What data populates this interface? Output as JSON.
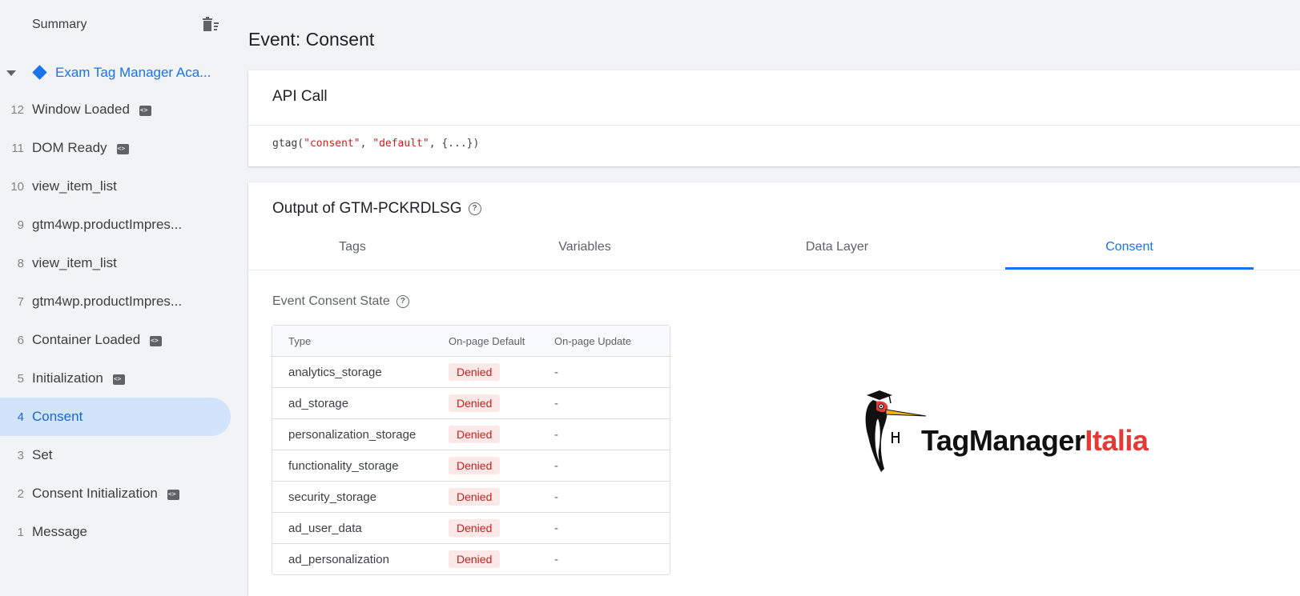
{
  "sidebar": {
    "summary_label": "Summary",
    "container_label": "Exam Tag Manager Aca...",
    "items": [
      {
        "num": "12",
        "label": "Window Loaded",
        "badge": true
      },
      {
        "num": "11",
        "label": "DOM Ready",
        "badge": true
      },
      {
        "num": "10",
        "label": "view_item_list",
        "badge": false
      },
      {
        "num": "9",
        "label": "gtm4wp.productImpres...",
        "badge": false
      },
      {
        "num": "8",
        "label": "view_item_list",
        "badge": false
      },
      {
        "num": "7",
        "label": "gtm4wp.productImpres...",
        "badge": false
      },
      {
        "num": "6",
        "label": "Container Loaded",
        "badge": true
      },
      {
        "num": "5",
        "label": "Initialization",
        "badge": true
      },
      {
        "num": "4",
        "label": "Consent",
        "badge": false,
        "active": true
      },
      {
        "num": "3",
        "label": "Set",
        "badge": false
      },
      {
        "num": "2",
        "label": "Consent Initialization",
        "badge": true
      },
      {
        "num": "1",
        "label": "Message",
        "badge": false
      }
    ]
  },
  "main": {
    "title": "Event: Consent",
    "api_call": {
      "title": "API Call",
      "code_fn": "gtag(",
      "code_arg1": "\"consent\"",
      "code_sep": ", ",
      "code_arg2": "\"default\"",
      "code_rest": ", {...})"
    },
    "output": {
      "title": "Output of GTM-PCKRDLSG",
      "tabs": [
        "Tags",
        "Variables",
        "Data Layer",
        "Consent"
      ],
      "active_tab": "Consent"
    },
    "consent_state": {
      "title": "Event Consent State",
      "headers": [
        "Type",
        "On-page Default",
        "On-page Update"
      ],
      "rows": [
        {
          "type": "analytics_storage",
          "default": "Denied",
          "update": "-"
        },
        {
          "type": "ad_storage",
          "default": "Denied",
          "update": "-"
        },
        {
          "type": "personalization_storage",
          "default": "Denied",
          "update": "-"
        },
        {
          "type": "functionality_storage",
          "default": "Denied",
          "update": "-"
        },
        {
          "type": "security_storage",
          "default": "Denied",
          "update": "-"
        },
        {
          "type": "ad_user_data",
          "default": "Denied",
          "update": "-"
        },
        {
          "type": "ad_personalization",
          "default": "Denied",
          "update": "-"
        }
      ]
    }
  },
  "watermark": {
    "text_part1": "TagManager",
    "text_part2": "Italia"
  },
  "colors": {
    "accent": "#1a73e8",
    "active_bg": "#d2e3fc",
    "denied_bg": "#fce8e6",
    "denied_text": "#c5221f",
    "logo_red": "#e53935"
  },
  "icons": [
    "trash-icon",
    "caret-down-icon",
    "container-diamond-icon",
    "code-badge-icon",
    "help-icon"
  ]
}
